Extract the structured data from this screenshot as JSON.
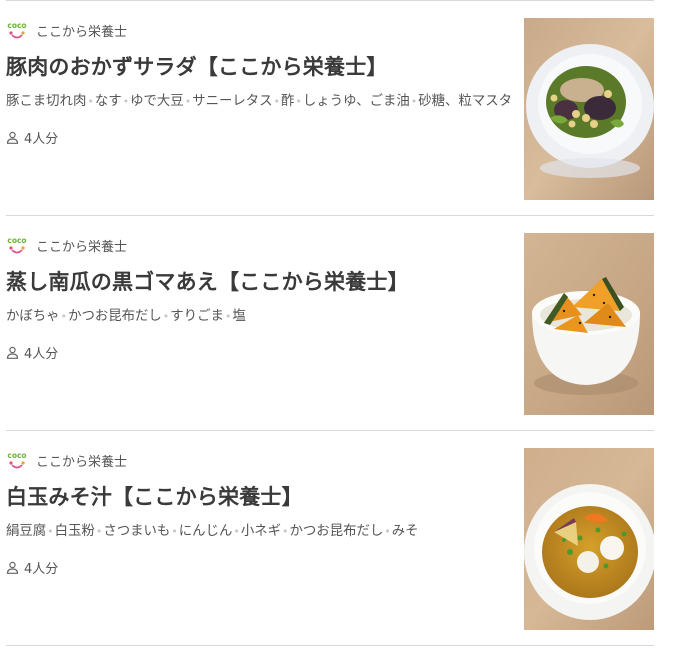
{
  "recipes": [
    {
      "author": "ここから栄養士",
      "logo_text": "coco",
      "title": "豚肉のおかずサラダ【ここから栄養士】",
      "ingredients": [
        "豚こま切れ肉",
        "なす",
        "ゆで大豆",
        "サニーレタス",
        "酢",
        "しょうゆ、ごま油",
        "砂糖、粒マスタード"
      ],
      "servings": "4人分",
      "icon": "person-icon",
      "image": "pork-salad-photo"
    },
    {
      "author": "ここから栄養士",
      "logo_text": "coco",
      "title": "蒸し南瓜の黒ゴマあえ【ここから栄養士】",
      "ingredients": [
        "かぼちゃ",
        "かつお昆布だし",
        "すりごま",
        "塩"
      ],
      "servings": "4人分",
      "icon": "person-icon",
      "image": "pumpkin-sesame-photo"
    },
    {
      "author": "ここから栄養士",
      "logo_text": "coco",
      "title": "白玉みそ汁【ここから栄養士】",
      "ingredients": [
        "絹豆腐",
        "白玉粉",
        "さつまいも",
        "にんじん",
        "小ネギ",
        "かつお昆布だし",
        "みそ"
      ],
      "servings": "4人分",
      "icon": "person-icon",
      "image": "shiratama-miso-soup-photo"
    }
  ],
  "colors": {
    "divider": "#d9d9d9",
    "title": "#3a3a3a",
    "text": "#555555",
    "separator_dot": "#c8c8c8",
    "logo_green": "#6bb33a",
    "logo_pink": "#e0508a"
  }
}
